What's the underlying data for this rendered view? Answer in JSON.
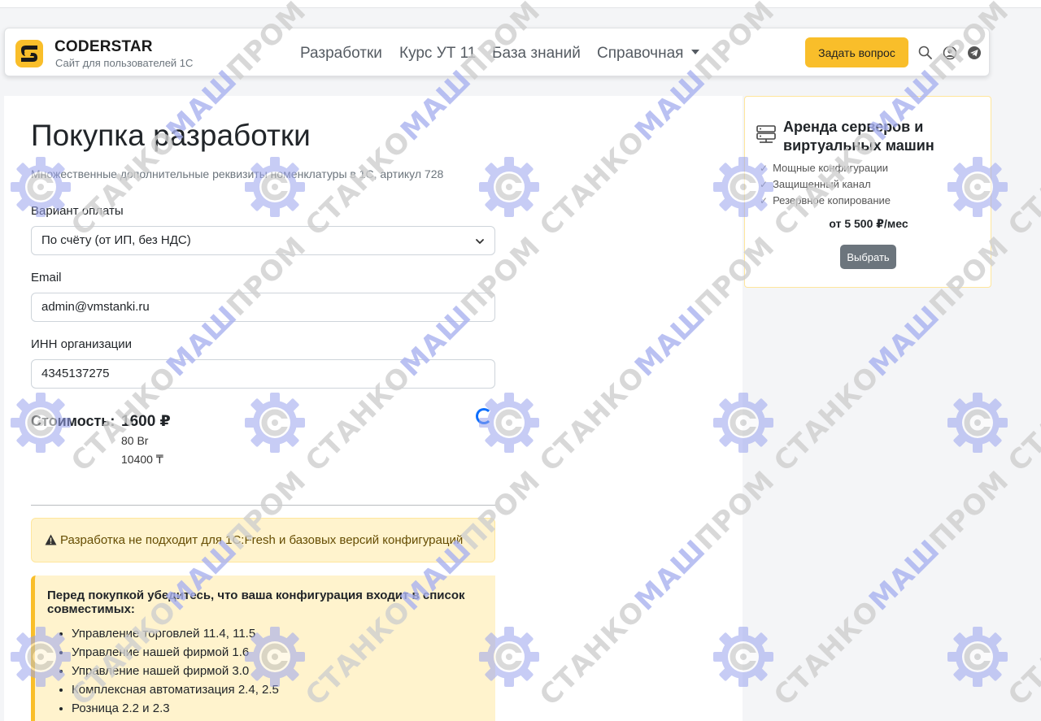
{
  "navbar": {
    "brand_title": "CODERSTAR",
    "brand_subtitle": "Сайт для пользователей 1С",
    "items": [
      "Разработки",
      "Курс УТ 11",
      "База знаний",
      "Справочная"
    ],
    "ask_button": "Задать вопрос",
    "accent_color": "#f9be2a"
  },
  "main": {
    "title": "Покупка разработки",
    "subtitle": "Множественные дополнительные реквизиты номенклатуры в 1С, артикул 728",
    "payment_label": "Вариант оплаты",
    "payment_value": "По счёту (от ИП, без НДС)",
    "email_label": "Email",
    "email_value": "admin@vmstanki.ru",
    "inn_label": "ИНН организации",
    "inn_value": "4345137275",
    "cost_label": "Стоимость:",
    "cost_main": "1600 ₽",
    "cost_byn": "80 Br",
    "cost_kzt": "10400 ₸",
    "warning_text": "Разработка не подходит для 1С:Fresh и базовых версий конфигураций",
    "compat_title": "Перед покупкой убедитесь, что ваша конфигурация входит в список совместимых:",
    "compat_list": [
      "Управление торговлей 11.4, 11.5",
      "Управление нашей фирмой 1.6",
      "Управление нашей фирмой 3.0",
      "Комплексная автоматизация 2.4, 2.5",
      "Розница 2.2 и 2.3"
    ]
  },
  "sidebar": {
    "title": "Аренда серверов и виртуальных машин",
    "features": [
      "Мощные конфигурации",
      "Защищенный канал",
      "Резервное копирование"
    ],
    "price": "от 5 500 ₽/мес",
    "button": "Выбрать"
  },
  "watermark": {
    "prefix": "СТАНКО",
    "middle": "МАШ",
    "suffix": "ПРОМ"
  }
}
